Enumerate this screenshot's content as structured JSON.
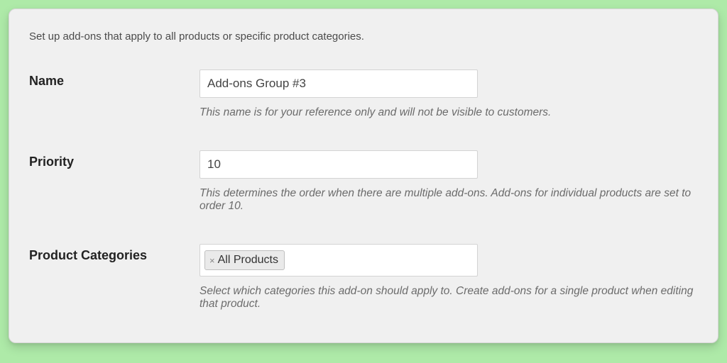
{
  "intro": "Set up add-ons that apply to all products or specific product categories.",
  "fields": {
    "name": {
      "label": "Name",
      "value": "Add-ons Group #3",
      "helper": "This name is for your reference only and will not be visible to customers."
    },
    "priority": {
      "label": "Priority",
      "value": "10",
      "helper": "This determines the order when there are multiple add-ons. Add-ons for individual products are set to order 10."
    },
    "categories": {
      "label": "Product Categories",
      "tags": [
        {
          "remove": "×",
          "text": "All Products"
        }
      ],
      "helper": "Select which categories this add-on should apply to. Create add-ons for a single product when editing that product."
    }
  }
}
